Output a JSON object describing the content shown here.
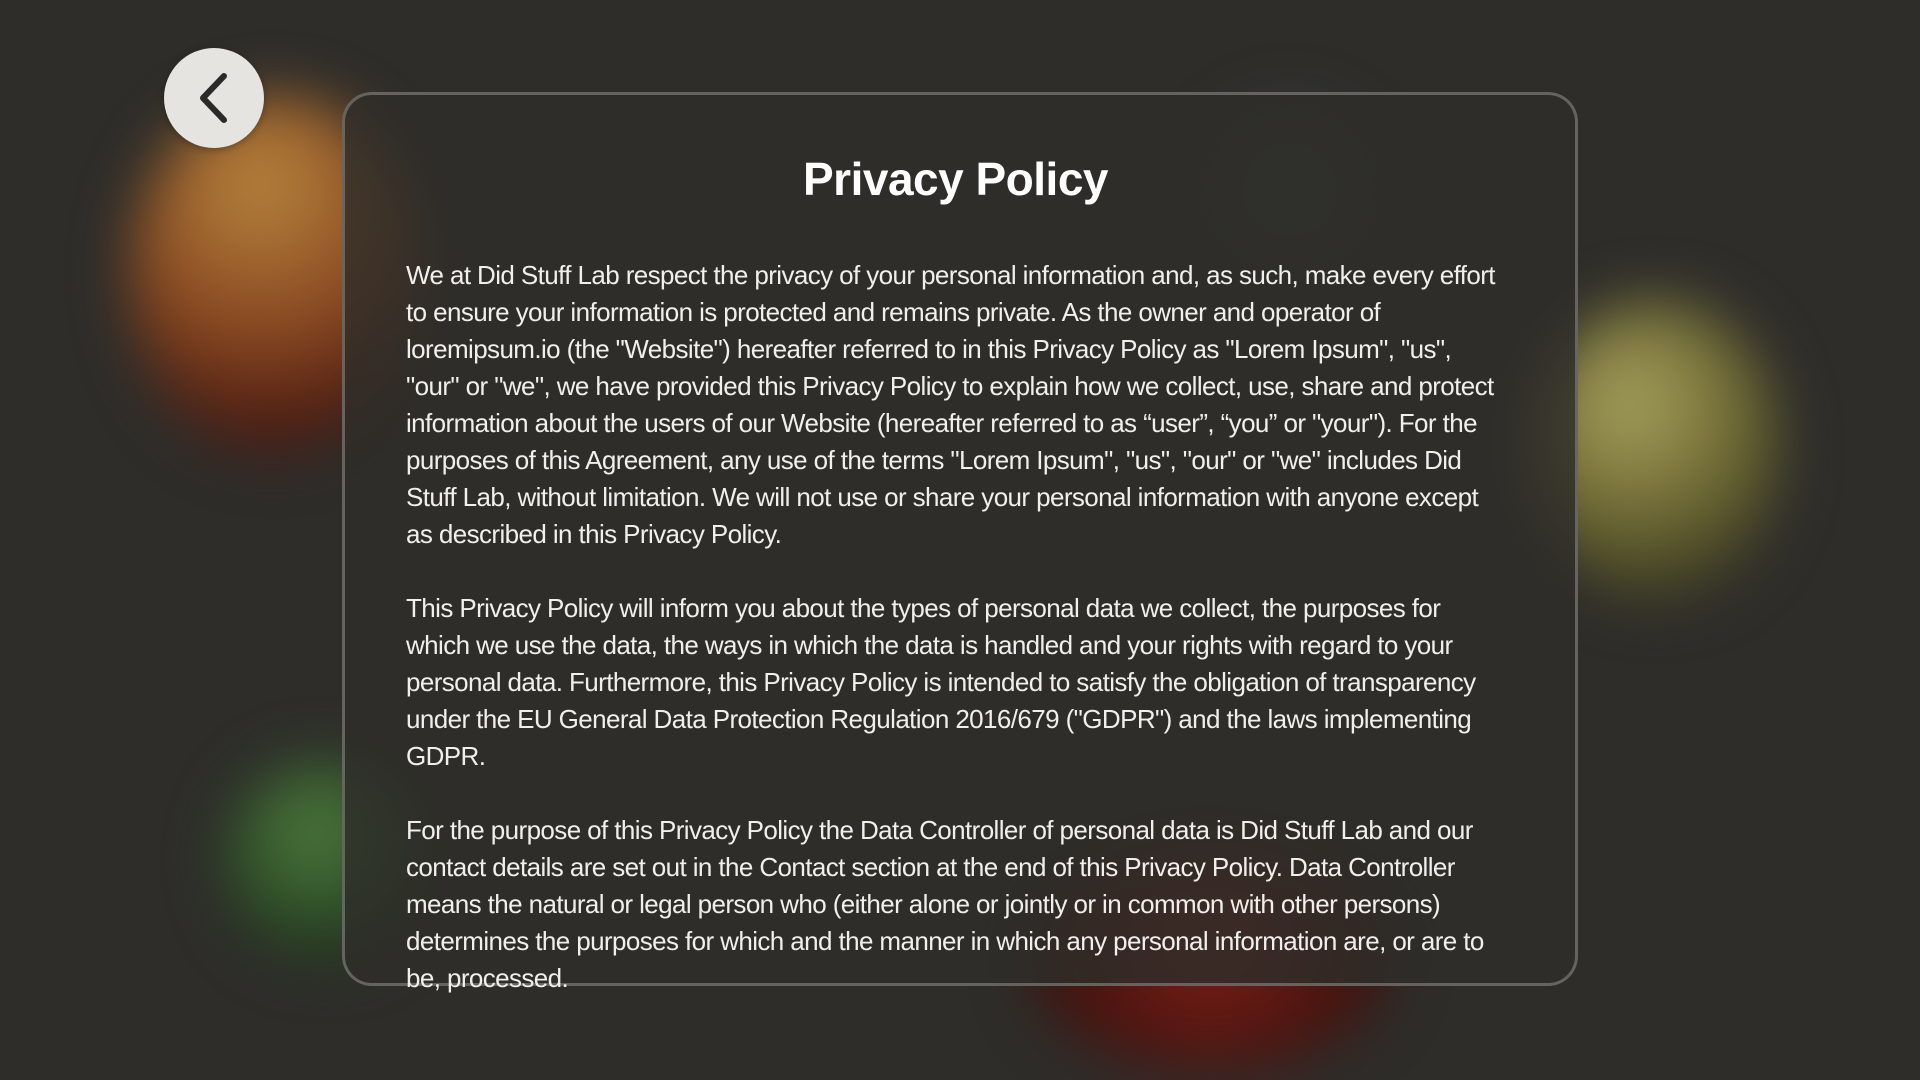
{
  "back_button": {
    "icon": "chevron-left-icon",
    "color": "#e6e4e1"
  },
  "policy": {
    "title": "Privacy Policy",
    "paragraphs": [
      "We at Did Stuff Lab respect the privacy of your personal information and, as such, make every effort to ensure your information is protected and remains private. As the owner and operator of loremipsum.io (the \"Website\") hereafter referred to in this Privacy Policy as \"Lorem Ipsum\", \"us\", \"our\" or \"we\", we have provided this Privacy Policy to explain how we collect, use, share and protect information about the users of our Website (hereafter referred to as “user”, “you” or \"your\"). For the purposes of this Agreement, any use of the terms \"Lorem Ipsum\", \"us\", \"our\" or \"we\" includes Did Stuff Lab, without limitation. We will not use or share your personal information with anyone except as described in this Privacy Policy.",
      "This Privacy Policy will inform you about the types of personal data we collect, the purposes for which we use the data, the ways in which the data is handled and your rights with regard to your personal data. Furthermore, this Privacy Policy is intended to satisfy the obligation of transparency under the EU General Data Protection Regulation 2016/679 (\"GDPR\") and the laws implementing GDPR.",
      "For the purpose of this Privacy Policy the Data Controller of personal data is Did Stuff Lab and our contact details are set out in the Contact section at the end of this Privacy Policy. Data Controller means the natural or legal person who (either alone or jointly or in common with other persons) determines the purposes for which and the manner in which any personal information are, or are to be, processed."
    ]
  },
  "colors": {
    "background": "#2e2d2a",
    "card_border": "#787672",
    "text": "#ffffff"
  }
}
